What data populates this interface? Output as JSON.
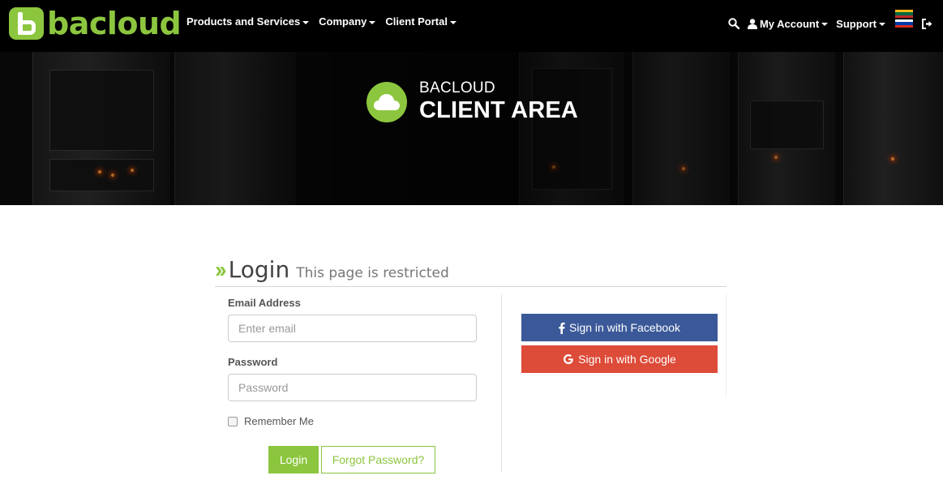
{
  "brand": {
    "name": "bacloud",
    "accent": "#8cc63f"
  },
  "nav": {
    "left": [
      {
        "label": "Products and Services",
        "icon": "caret-down-icon"
      },
      {
        "label": "Company",
        "icon": "caret-down-icon"
      },
      {
        "label": "Client Portal",
        "icon": "caret-down-icon"
      }
    ],
    "right": {
      "search_icon": "search-icon",
      "account_label": "My Account",
      "support_label": "Support",
      "flags": [
        "lithuania-flag",
        "russia-flag"
      ],
      "logout_icon": "logout-icon"
    }
  },
  "hero": {
    "subtitle": "BACLOUD",
    "title": "CLIENT AREA",
    "icon": "cloud-icon"
  },
  "login": {
    "title": "Login",
    "subtitle": "This page is restricted",
    "email_label": "Email Address",
    "email_placeholder": "Enter email",
    "password_label": "Password",
    "password_placeholder": "Password",
    "remember_label": "Remember Me",
    "login_button": "Login",
    "forgot_button": "Forgot Password?"
  },
  "social": {
    "facebook": {
      "label": "Sign in with Facebook",
      "color": "#3b5998"
    },
    "google": {
      "label": "Sign in with Google",
      "color": "#dd4b39"
    }
  }
}
